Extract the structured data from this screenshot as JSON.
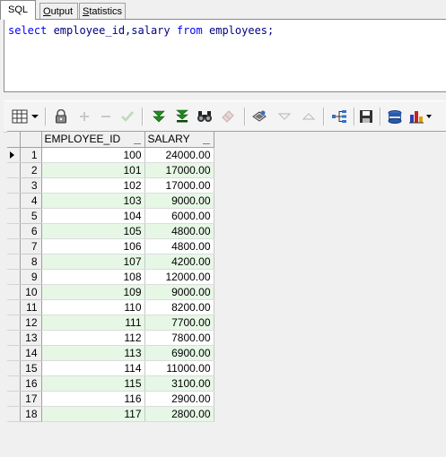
{
  "tabs": [
    {
      "label": "SQL",
      "active": true
    },
    {
      "label": "Output",
      "active": false
    },
    {
      "label": "Statistics",
      "active": false
    }
  ],
  "editor": {
    "tokens": [
      {
        "text": "select",
        "kind": "kw"
      },
      {
        "text": " employee_id,salary ",
        "kind": "plain"
      },
      {
        "text": "from",
        "kind": "kw"
      },
      {
        "text": " employees;",
        "kind": "plain"
      }
    ]
  },
  "toolbar": {
    "icons": [
      "grid-layout-icon",
      "dropdown-arrow-icon",
      "lock-icon",
      "add-record-icon",
      "delete-record-icon",
      "post-edit-icon",
      "fetch-next-icon",
      "fetch-all-icon",
      "find-icon",
      "clear-icon",
      "query-by-example-icon",
      "sort-descending-icon",
      "sort-ascending-icon",
      "explain-plan-icon",
      "save-icon",
      "export-icon",
      "chart-icon"
    ]
  },
  "grid": {
    "columns": [
      "EMPLOYEE_ID",
      "SALARY"
    ],
    "current_row": 1,
    "rows": [
      {
        "n": "1",
        "employee_id": "100",
        "salary": "24000.00"
      },
      {
        "n": "2",
        "employee_id": "101",
        "salary": "17000.00"
      },
      {
        "n": "3",
        "employee_id": "102",
        "salary": "17000.00"
      },
      {
        "n": "4",
        "employee_id": "103",
        "salary": "9000.00"
      },
      {
        "n": "5",
        "employee_id": "104",
        "salary": "6000.00"
      },
      {
        "n": "6",
        "employee_id": "105",
        "salary": "4800.00"
      },
      {
        "n": "7",
        "employee_id": "106",
        "salary": "4800.00"
      },
      {
        "n": "8",
        "employee_id": "107",
        "salary": "4200.00"
      },
      {
        "n": "9",
        "employee_id": "108",
        "salary": "12000.00"
      },
      {
        "n": "10",
        "employee_id": "109",
        "salary": "9000.00"
      },
      {
        "n": "11",
        "employee_id": "110",
        "salary": "8200.00"
      },
      {
        "n": "12",
        "employee_id": "111",
        "salary": "7700.00"
      },
      {
        "n": "13",
        "employee_id": "112",
        "salary": "7800.00"
      },
      {
        "n": "14",
        "employee_id": "113",
        "salary": "6900.00"
      },
      {
        "n": "15",
        "employee_id": "114",
        "salary": "11000.00"
      },
      {
        "n": "16",
        "employee_id": "115",
        "salary": "3100.00"
      },
      {
        "n": "17",
        "employee_id": "116",
        "salary": "2900.00"
      },
      {
        "n": "18",
        "employee_id": "117",
        "salary": "2800.00"
      }
    ]
  }
}
